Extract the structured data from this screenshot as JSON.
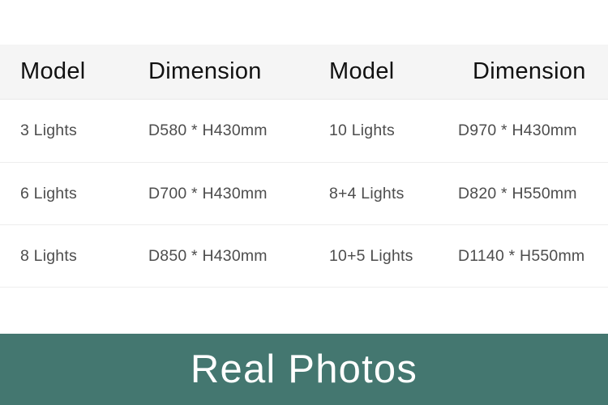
{
  "theme": {
    "page_background": "#ffffff",
    "header_row_background": "#f5f5f5",
    "header_text_color": "#111111",
    "body_text_color": "#4d4d4d",
    "row_divider_color": "#eeeeee",
    "banner_background": "#447770",
    "banner_text_color": "#ffffff"
  },
  "spec_table": {
    "columns": [
      {
        "label": "Model"
      },
      {
        "label": "Dimension"
      },
      {
        "label": "Model"
      },
      {
        "label": "Dimension"
      }
    ],
    "rows": [
      {
        "model_left": "3 Lights",
        "dimension_left": "D580 * H430mm",
        "model_right": "10 Lights",
        "dimension_right": "D970 * H430mm"
      },
      {
        "model_left": "6 Lights",
        "dimension_left": "D700 * H430mm",
        "model_right": "8+4 Lights",
        "dimension_right": "D820 * H550mm"
      },
      {
        "model_left": "8 Lights",
        "dimension_left": "D850 * H430mm",
        "model_right": "10+5 Lights",
        "dimension_right": "D1140 * H550mm"
      }
    ]
  },
  "banner": {
    "title": "Real Photos"
  }
}
